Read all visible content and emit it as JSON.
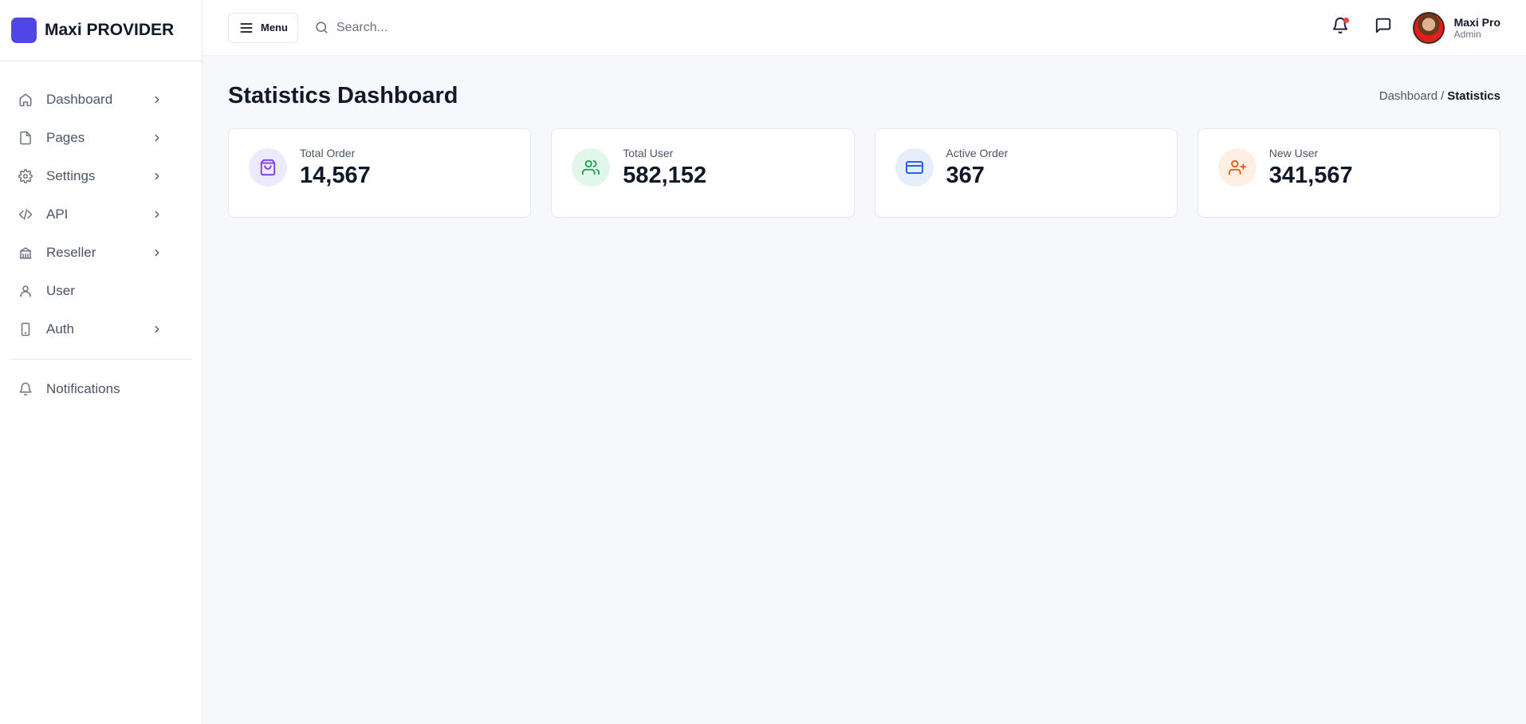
{
  "brand": {
    "name": "Maxi PROVIDER",
    "color": "#4f46e5"
  },
  "sidebar": {
    "items": [
      {
        "label": "Dashboard",
        "icon": "home-icon",
        "has_chevron": true
      },
      {
        "label": "Pages",
        "icon": "file-icon",
        "has_chevron": true
      },
      {
        "label": "Settings",
        "icon": "gear-icon",
        "has_chevron": true
      },
      {
        "label": "API",
        "icon": "code-icon",
        "has_chevron": true
      },
      {
        "label": "Reseller",
        "icon": "building-icon",
        "has_chevron": true
      },
      {
        "label": "User",
        "icon": "user-icon",
        "has_chevron": false
      },
      {
        "label": "Auth",
        "icon": "phone-icon",
        "has_chevron": true
      }
    ],
    "secondary": [
      {
        "label": "Notifications",
        "icon": "bell-icon"
      }
    ]
  },
  "topbar": {
    "menu_label": "Menu",
    "search_placeholder": "Search...",
    "user": {
      "name": "Maxi Pro",
      "role": "Admin"
    }
  },
  "page": {
    "title": "Statistics Dashboard",
    "breadcrumb": [
      "Dashboard",
      "Statistics"
    ]
  },
  "stats": [
    {
      "label": "Total Order",
      "value": "14,567",
      "icon": "shopping-bag-icon",
      "color": "#7c3aed",
      "bg": "#ede9fe"
    },
    {
      "label": "Total User",
      "value": "582,152",
      "icon": "users-icon",
      "color": "#16a34a",
      "bg": "#e3f6ec"
    },
    {
      "label": "Active Order",
      "value": "367",
      "icon": "credit-card-icon",
      "color": "#2563eb",
      "bg": "#e6edfb"
    },
    {
      "label": "New User",
      "value": "341,567",
      "icon": "user-plus-icon",
      "color": "#ea580c",
      "bg": "#fdefe3"
    }
  ]
}
